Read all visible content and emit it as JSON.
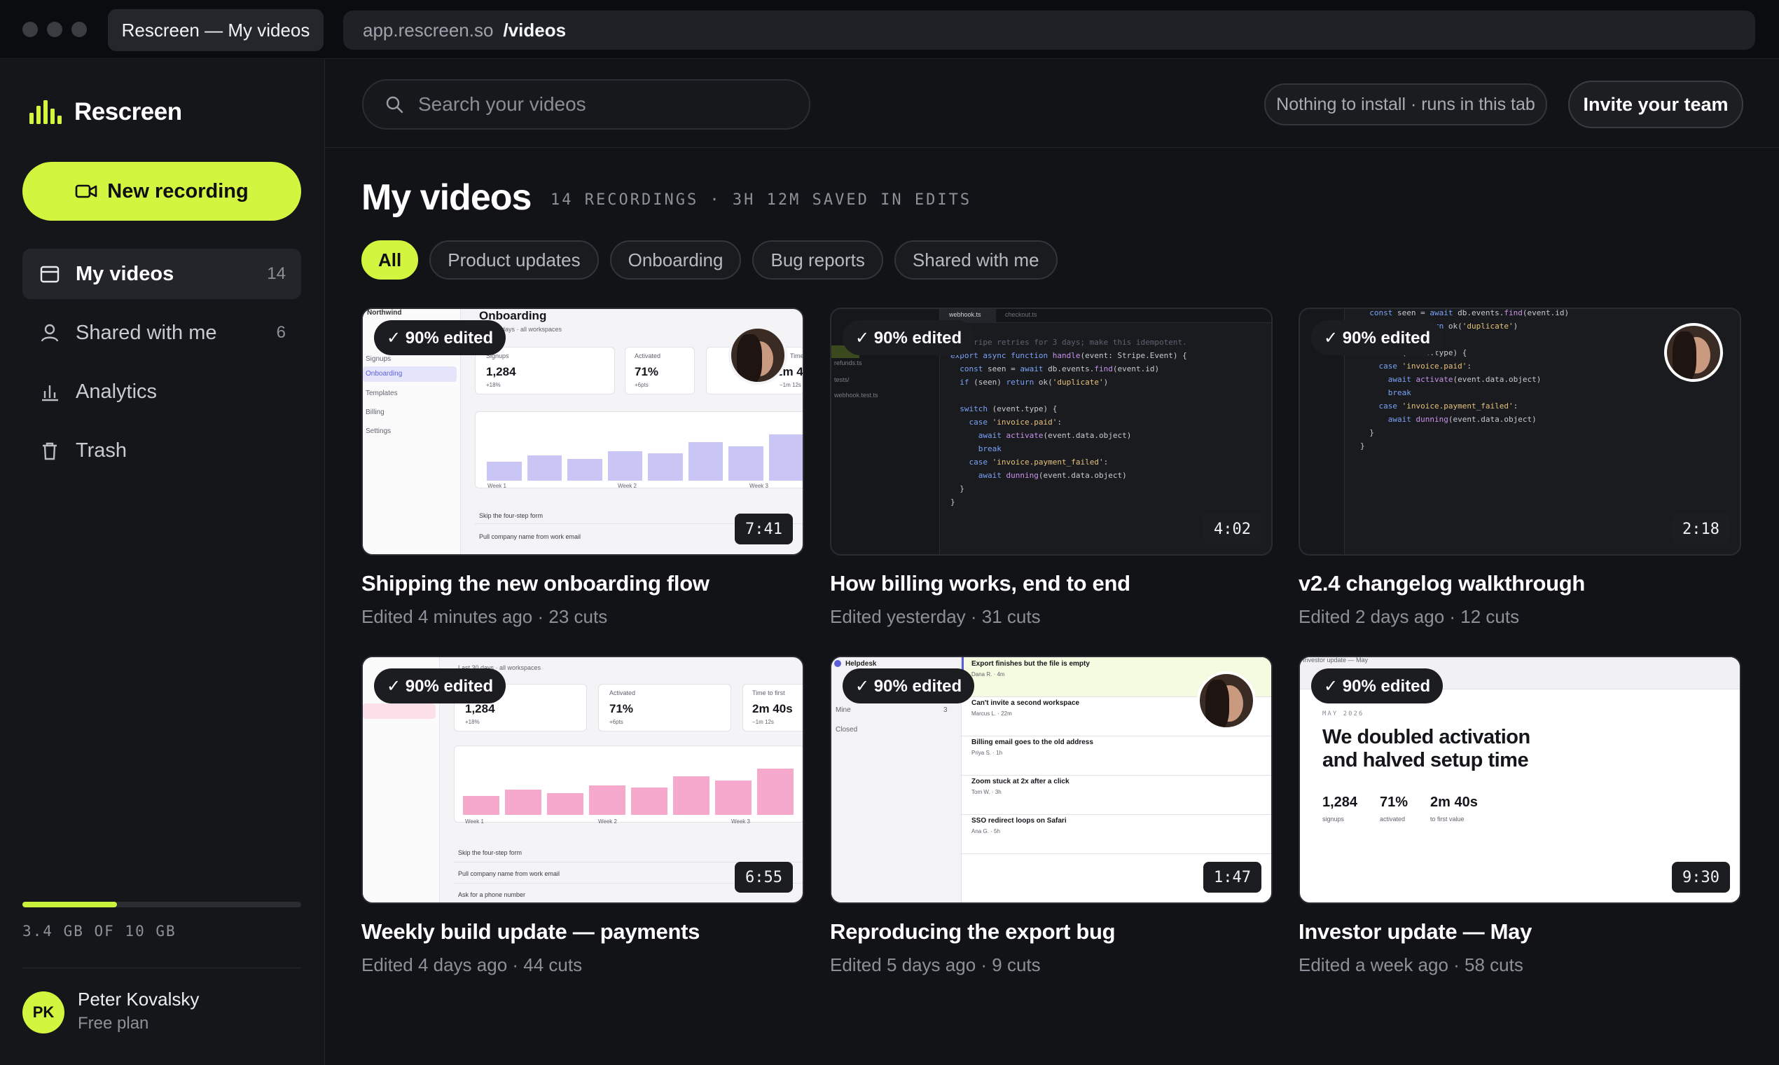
{
  "browser": {
    "tab_title": "Rescreen — My videos",
    "url_host": "app.rescreen.so",
    "url_path": "/videos"
  },
  "sidebar": {
    "brand": "Rescreen",
    "new_recording": "New recording",
    "items": [
      {
        "label": "My videos",
        "count": "14",
        "icon": "calendar-icon",
        "active": true
      },
      {
        "label": "Shared with me",
        "count": "6",
        "icon": "user-icon"
      },
      {
        "label": "Analytics",
        "count": "",
        "icon": "bar-chart-icon"
      },
      {
        "label": "Trash",
        "count": "",
        "icon": "trash-icon"
      }
    ],
    "storage": {
      "text": "3.4 GB OF 10 GB",
      "used_fraction": 0.34
    },
    "user": {
      "initials": "PK",
      "name": "Peter Kovalsky",
      "plan": "Free plan"
    }
  },
  "topbar": {
    "search_placeholder": "Search your videos",
    "install_note": "Nothing to install · runs in this tab",
    "invite": "Invite your team"
  },
  "main": {
    "title": "My videos",
    "meta": "14 RECORDINGS · 3H 12M SAVED IN EDITS",
    "filters": [
      "All",
      "Product updates",
      "Onboarding",
      "Bug reports",
      "Shared with me"
    ],
    "active_filter": "All",
    "videos": [
      {
        "title": "Shipping the new onboarding flow",
        "meta": "Edited 4 minutes ago · 23 cuts",
        "badge": "✓ 90% edited",
        "duration": "7:41"
      },
      {
        "title": "How billing works, end to end",
        "meta": "Edited yesterday · 31 cuts",
        "badge": "✓ 90% edited",
        "duration": "4:02"
      },
      {
        "title": "v2.4 changelog walkthrough",
        "meta": "Edited 2 days ago · 12 cuts",
        "badge": "✓ 90% edited",
        "duration": "2:18"
      },
      {
        "title": "Weekly build update — payments",
        "meta": "Edited 4 days ago · 44 cuts",
        "badge": "✓ 90% edited",
        "duration": "6:55"
      },
      {
        "title": "Reproducing the export bug",
        "meta": "Edited 5 days ago · 9 cuts",
        "badge": "✓ 90% edited",
        "duration": "1:47"
      },
      {
        "title": "Investor update — May",
        "meta": "Edited a week ago · 58 cuts",
        "badge": "✓ 90% edited",
        "duration": "9:30"
      }
    ]
  },
  "thumbs": {
    "onboarding": {
      "heading": "Onboarding",
      "sub": "Last 30 days · all workspaces",
      "stats": [
        {
          "label": "Signups",
          "value": "1,284",
          "delta": "+18%"
        },
        {
          "label": "Activated",
          "value": "71%",
          "delta": "+6pts"
        },
        {
          "label": "Time to first",
          "value": "2m 40s",
          "delta": "−1m 12s"
        }
      ],
      "nav": [
        "Northwind",
        "Signups",
        "Onboarding",
        "Templates",
        "Billing",
        "Settings"
      ],
      "weeks": [
        "Week 1",
        "Week 2",
        "Week 3"
      ],
      "tasks": [
        "Skip the four-step form",
        "Pull company name from work email",
        "Ask for a phone number"
      ]
    },
    "billing": {
      "tabs": [
        "webhook.ts",
        "checkout.ts"
      ],
      "files": [
        "webhook.ts",
        "refunds.ts",
        "tests/",
        "webhook.test.ts"
      ]
    },
    "bugs": {
      "app": "Helpdesk",
      "filters": [
        {
          "label": "Mine",
          "count": "3"
        },
        {
          "label": "Closed",
          "count": ""
        }
      ],
      "tickets": [
        {
          "title": "Export finishes but the file is empty",
          "by": "Dana R. · 4m"
        },
        {
          "title": "Can't invite a second workspace",
          "by": "Marcus L. · 22m"
        },
        {
          "title": "Billing email goes to the old address",
          "by": "Priya S. · 1h"
        },
        {
          "title": "Zoom stuck at 2x after a click",
          "by": "Tom W. · 3h"
        },
        {
          "title": "SSO redirect loops on Safari",
          "by": "Ana G. · 5h"
        }
      ]
    },
    "investor": {
      "top": "Investor update — May",
      "date": "MAY 2026",
      "headline_1": "We doubled activation",
      "headline_2": "and halved setup time",
      "stats": [
        {
          "value": "1,284",
          "label": "signups"
        },
        {
          "value": "71%",
          "label": "activated"
        },
        {
          "value": "2m 40s",
          "label": "to first value"
        }
      ]
    }
  },
  "colors": {
    "accent": "#d2f63f",
    "background": "#121317",
    "sidebar": "#15161a"
  }
}
